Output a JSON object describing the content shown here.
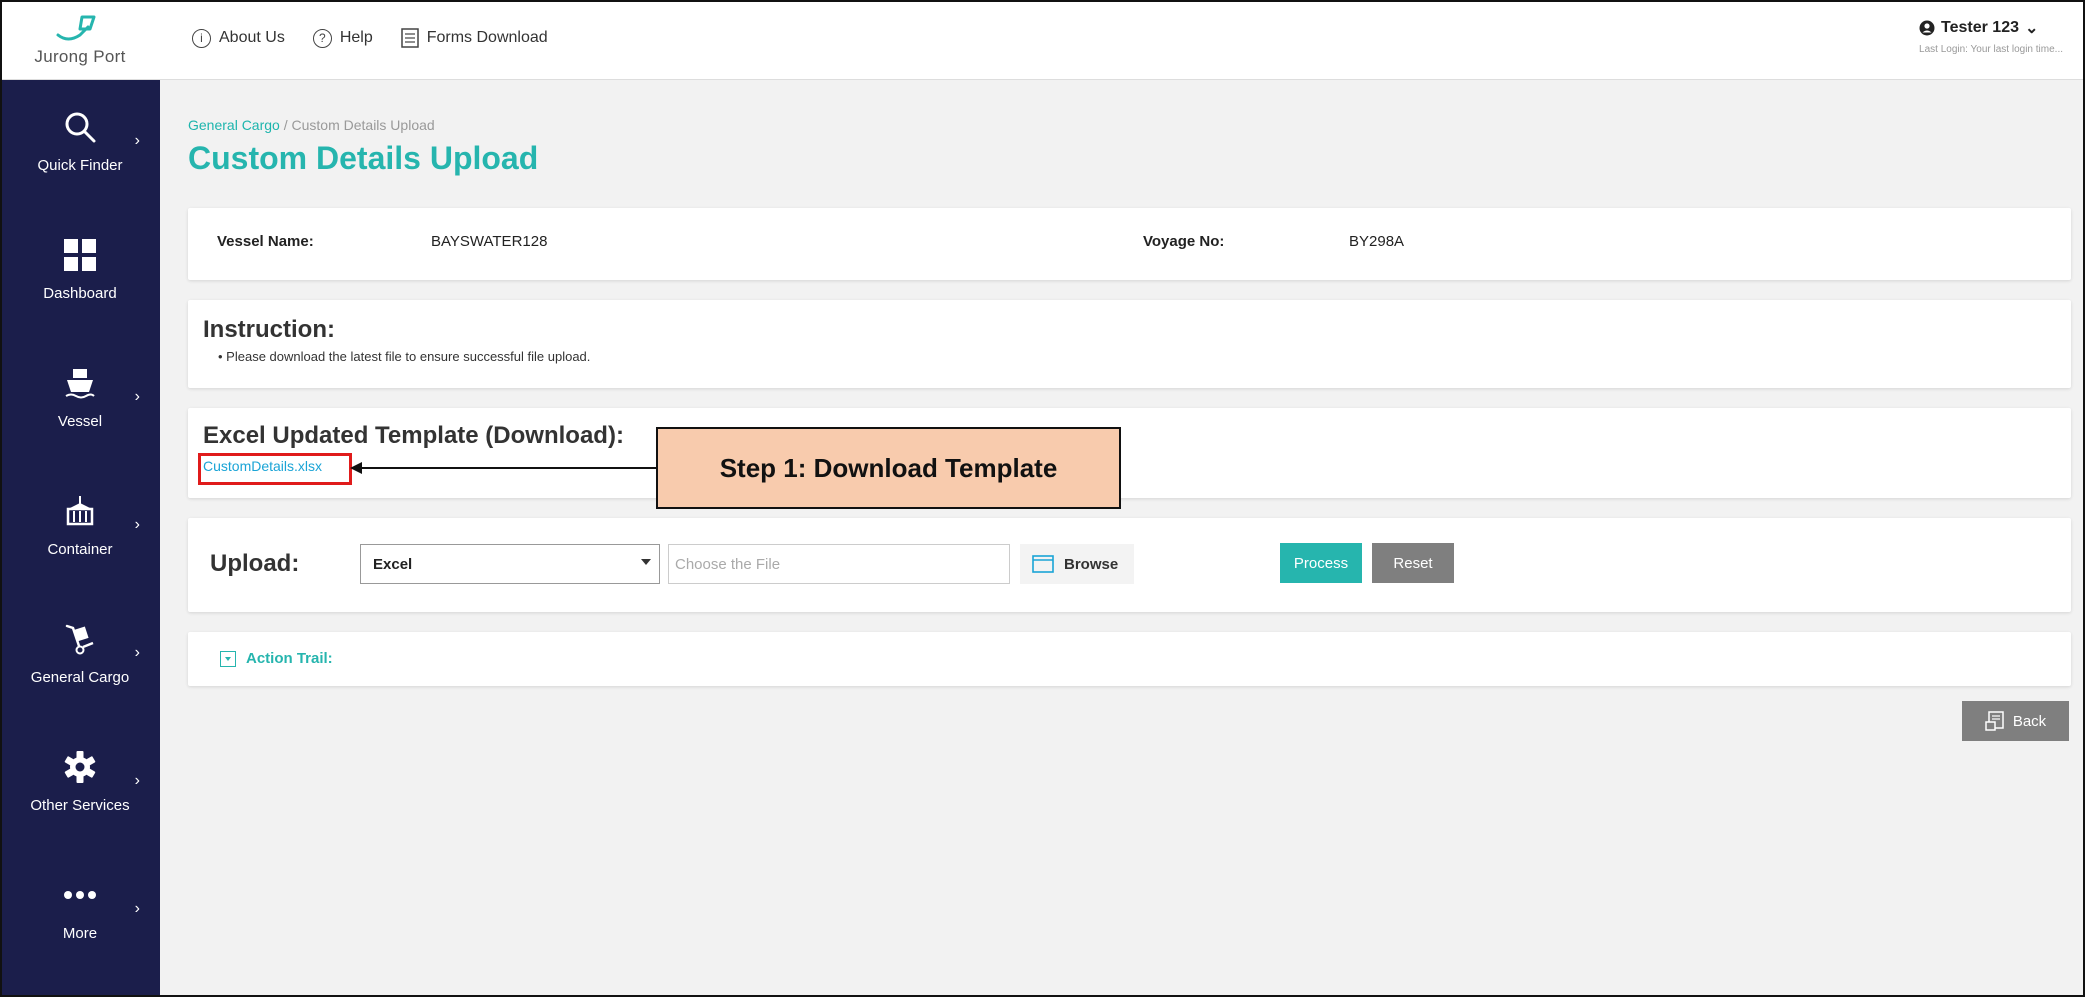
{
  "brand": {
    "name": "Jurong Port",
    "accent": "#26b5ae",
    "sidebar_bg": "#1b1e4b"
  },
  "header": {
    "links": [
      {
        "label": "About Us",
        "icon": "info-circle-icon"
      },
      {
        "label": "Help",
        "icon": "question-circle-icon"
      },
      {
        "label": "Forms Download",
        "icon": "document-icon"
      }
    ],
    "user": {
      "name": "Tester 123",
      "last_login": "Last Login: Your last login time..."
    }
  },
  "sidebar": {
    "items": [
      {
        "label": "Quick Finder",
        "icon": "search-icon",
        "has_submenu": true
      },
      {
        "label": "Dashboard",
        "icon": "grid-icon",
        "has_submenu": false
      },
      {
        "label": "Vessel",
        "icon": "ship-icon",
        "has_submenu": true
      },
      {
        "label": "Container",
        "icon": "container-crane-icon",
        "has_submenu": true
      },
      {
        "label": "General Cargo",
        "icon": "hand-truck-icon",
        "has_submenu": true
      },
      {
        "label": "Other Services",
        "icon": "gear-icon",
        "has_submenu": true
      },
      {
        "label": "More",
        "icon": "more-dots-icon",
        "has_submenu": true
      }
    ],
    "chevron": "›"
  },
  "breadcrumb": {
    "parent": "General Cargo",
    "separator": " / ",
    "current": "Custom Details Upload"
  },
  "page_title": "Custom Details Upload",
  "vessel": {
    "name_label": "Vessel Name:",
    "name_value": "BAYSWATER128",
    "voyage_label": "Voyage No:",
    "voyage_value": "BY298A"
  },
  "instruction": {
    "heading": "Instruction:",
    "items": [
      "Please download the latest file to ensure successful file upload."
    ]
  },
  "template": {
    "heading": "Excel Updated Template (Download):",
    "link": "CustomDetails.xlsx",
    "callout": "Step 1: Download Template"
  },
  "upload": {
    "label": "Upload:",
    "type_selected": "Excel",
    "file_placeholder": "Choose the File",
    "browse_label": "Browse",
    "process_label": "Process",
    "reset_label": "Reset"
  },
  "action_trail": {
    "label": "Action Trail:"
  },
  "back_label": "Back"
}
